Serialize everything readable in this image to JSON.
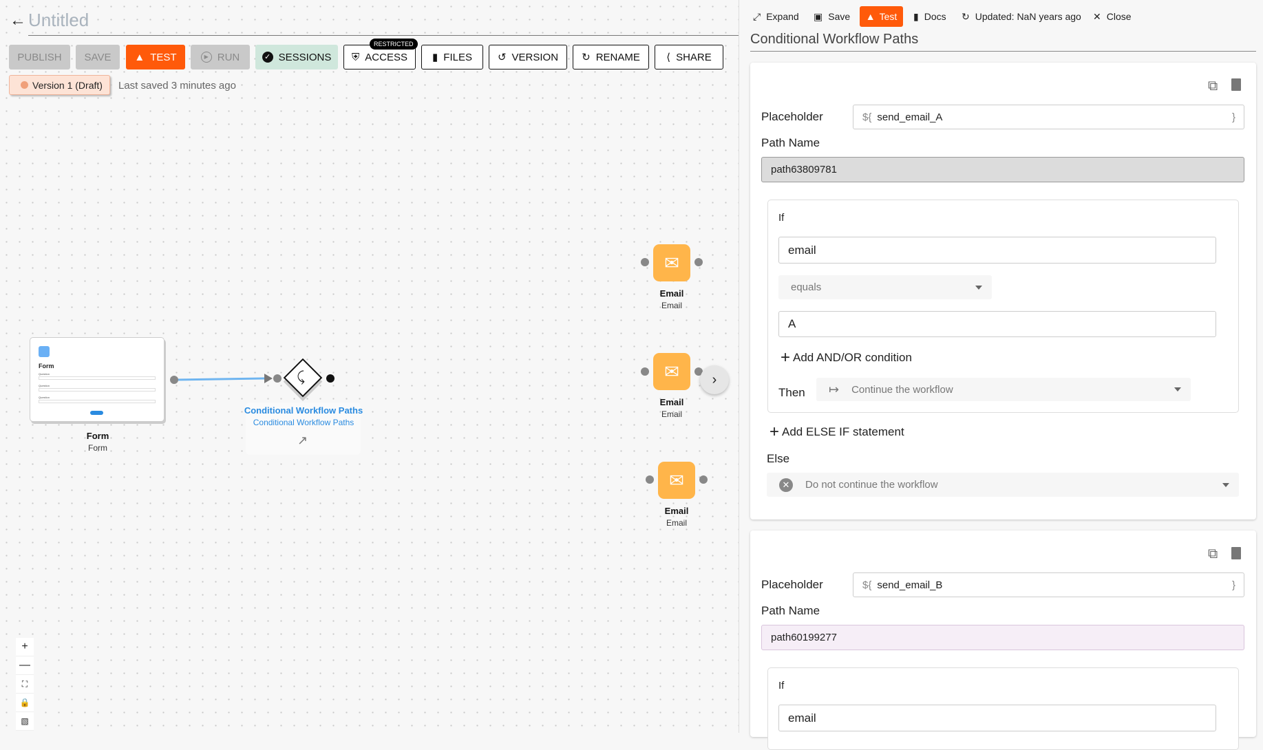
{
  "header": {
    "title": "Untitled"
  },
  "toolbar": {
    "publish": "PUBLISH",
    "save": "SAVE",
    "test": "TEST",
    "run": "RUN",
    "sessions": "SESSIONS",
    "access": "ACCESS",
    "access_badge": "RESTRICTED",
    "files": "FILES",
    "version": "VERSION",
    "rename": "RENAME",
    "share": "SHARE"
  },
  "version_badge": "Version 1 (Draft)",
  "last_saved": "Last saved 3 minutes ago",
  "nodes": {
    "form": {
      "title": "Form",
      "subtitle": "Form",
      "card_title": "Form",
      "questions": [
        "Question",
        "Question",
        "Question"
      ]
    },
    "conditional": {
      "title": "Conditional Workflow Paths",
      "subtitle": "Conditional Workflow Paths"
    },
    "emails": [
      {
        "title": "Email",
        "subtitle": "Email"
      },
      {
        "title": "Email",
        "subtitle": "Email"
      },
      {
        "title": "Email",
        "subtitle": "Email"
      }
    ]
  },
  "colors": {
    "accent": "#ff5a0a",
    "email_node": "#ffb54a",
    "link": "#2a8be0",
    "edge": "#6fb5f0"
  },
  "panel": {
    "toolbar": {
      "expand": "Expand",
      "save": "Save",
      "test": "Test",
      "docs": "Docs",
      "updated": "Updated: NaN years ago",
      "close": "Close"
    },
    "title": "Conditional Workflow Paths",
    "paths": [
      {
        "placeholder_label": "Placeholder",
        "placeholder_prefix": "${",
        "placeholder_value": "send_email_A",
        "placeholder_suffix": "}",
        "path_name_label": "Path Name",
        "path_name": "path63809781",
        "if_label": "If",
        "field": "email",
        "operator": "equals",
        "value": "A",
        "add_condition": "Add AND/OR condition",
        "then_label": "Then",
        "then_action": "Continue the workflow",
        "add_else_if": "Add ELSE IF statement",
        "else_label": "Else",
        "else_action": "Do not continue the workflow"
      },
      {
        "placeholder_label": "Placeholder",
        "placeholder_prefix": "${",
        "placeholder_value": "send_email_B",
        "placeholder_suffix": "}",
        "path_name_label": "Path Name",
        "path_name": "path60199277",
        "if_label": "If",
        "field": "email"
      }
    ]
  }
}
